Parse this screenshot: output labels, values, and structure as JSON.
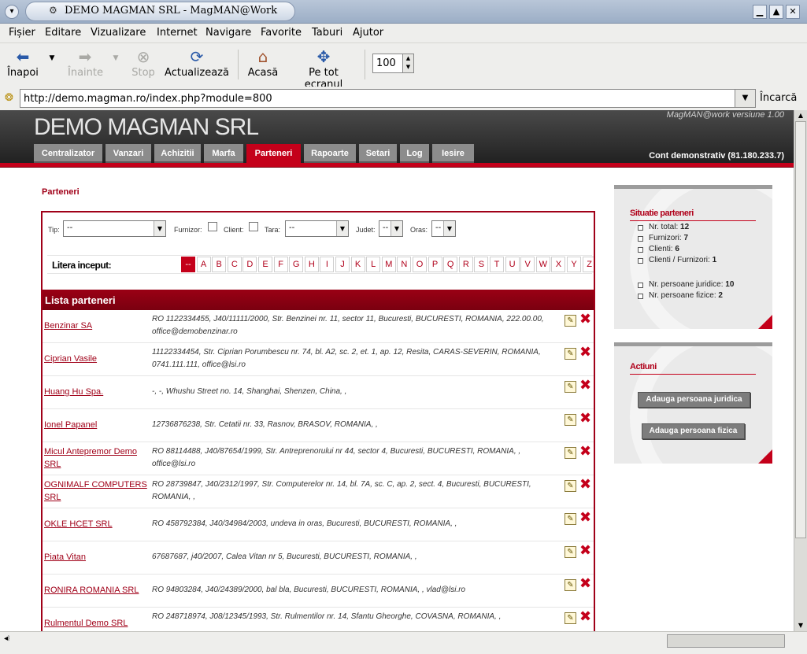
{
  "window": {
    "title": "DEMO MAGMAN SRL - MagMAN@Work"
  },
  "menu": [
    "Fișier",
    "Editare",
    "Vizualizare",
    "Internet",
    "Navigare",
    "Favorite",
    "Taburi",
    "Ajutor"
  ],
  "toolbar": {
    "back": "Înapoi",
    "forward": "Înainte",
    "stop": "Stop",
    "reload": "Actualizează",
    "home": "Acasă",
    "fullscreen": "Pe tot ecranul",
    "zoom": "100"
  },
  "address": {
    "url": "http://demo.magman.ro/index.php?module=800",
    "go": "Încarcă"
  },
  "site": {
    "title": "DEMO MAGMAN SRL",
    "version": "MagMAN@work versiune 1.00",
    "account": "Cont demonstrativ (81.180.233.7)",
    "nav": [
      "Centralizator",
      "Vanzari",
      "Achizitii",
      "Marfa",
      "Parteneri",
      "Rapoarte",
      "Setari",
      "Log",
      "Iesire"
    ],
    "active_nav": "Parteneri"
  },
  "page": {
    "heading": "Parteneri",
    "filters": {
      "tip_label": "Tip:",
      "tip_value": "--",
      "furnizor_label": "Furnizor:",
      "client_label": "Client:",
      "tara_label": "Tara:",
      "tara_value": "--",
      "judet_label": "Judet:",
      "judet_value": "--",
      "oras_label": "Oras:",
      "oras_value": "--"
    },
    "litera_label": "Litera inceput:",
    "letters": [
      "--",
      "A",
      "B",
      "C",
      "D",
      "E",
      "F",
      "G",
      "H",
      "I",
      "J",
      "K",
      "L",
      "M",
      "N",
      "O",
      "P",
      "Q",
      "R",
      "S",
      "T",
      "U",
      "V",
      "W",
      "X",
      "Y",
      "Z"
    ],
    "list_title": "Lista parteneri",
    "partners": [
      {
        "name": "Benzinar SA",
        "details": "RO 1122334455, J40/11111/2000, Str. Benzinei nr. 11, sector 11, Bucuresti, BUCURESTI, ROMANIA, 222.00.00, office@demobenzinar.ro"
      },
      {
        "name": "Ciprian Vasile",
        "details": "11122334454, Str. Ciprian Porumbescu nr. 74, bl. A2, sc. 2, et. 1, ap. 12, Resita, CARAS-SEVERIN, ROMANIA, 0741.111.111, office@lsi.ro"
      },
      {
        "name": "Huang Hu Spa.",
        "details": "-, -, Whushu Street no. 14, Shanghai, Shenzen, China, ,"
      },
      {
        "name": "Ionel Papanel",
        "details": "12736876238, Str. Cetatii nr. 33, Rasnov, BRASOV, ROMANIA, ,"
      },
      {
        "name": "Micul Antepremor Demo SRL",
        "details": "RO 88114488, J40/87654/1999, Str. Antreprenorului nr 44, sector 4, Bucuresti, BUCURESTI, ROMANIA, , office@lsi.ro"
      },
      {
        "name": "OGNIMALF COMPUTERS SRL",
        "details": "RO 28739847, J40/2312/1997, Str. Computerelor nr. 14, bl. 7A, sc. C, ap. 2, sect. 4, Bucuresti, BUCURESTI, ROMANIA, ,"
      },
      {
        "name": "OKLE HCET SRL",
        "details": "RO 458792384, J40/34984/2003, undeva in oras, Bucuresti, BUCURESTI, ROMANIA, ,"
      },
      {
        "name": "Piata Vitan",
        "details": "67687687, j40/2007, Calea Vitan nr 5, Bucuresti, BUCURESTI, ROMANIA, ,"
      },
      {
        "name": "RONIRA ROMANIA SRL",
        "details": "RO 94803284, J40/24389/2000, bal bla, Bucuresti, BUCURESTI, ROMANIA, , vlad@lsi.ro"
      },
      {
        "name": "Rulmentul Demo SRL",
        "details": "RO 248718974, J08/12345/1993, Str. Rulmentilor nr. 14, Sfantu Gheorghe, COVASNA, ROMANIA, ,"
      }
    ]
  },
  "sidebar": {
    "situatie": {
      "title": "Situatie parteneri",
      "stats": [
        {
          "label": "Nr. total:",
          "value": "12"
        },
        {
          "label": "Furnizori:",
          "value": "7"
        },
        {
          "label": "Clienti:",
          "value": "6"
        },
        {
          "label": "Clienti / Furnizori:",
          "value": "1"
        },
        {
          "label": "Nr. persoane juridice:",
          "value": "10"
        },
        {
          "label": "Nr. persoane fizice:",
          "value": "2"
        }
      ]
    },
    "actiuni": {
      "title": "Actiuni",
      "btn_juridica": "Adauga persoana juridica",
      "btn_fizica": "Adauga persoana fizica"
    }
  }
}
